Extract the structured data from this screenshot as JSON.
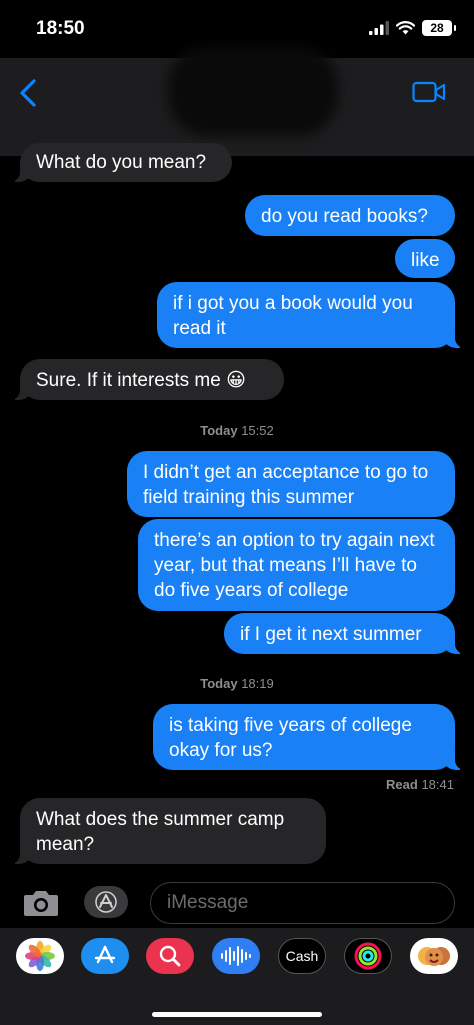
{
  "status_bar": {
    "time": "18:50",
    "battery": "28"
  },
  "messages": [
    {
      "id": "m1",
      "dir": "in",
      "text": "What do you mean?"
    },
    {
      "id": "m2",
      "dir": "out",
      "text": "do you read books?"
    },
    {
      "id": "m3",
      "dir": "out",
      "text": "like"
    },
    {
      "id": "m4",
      "dir": "out",
      "text": "if i got you a book would you read it"
    },
    {
      "id": "m5",
      "dir": "in",
      "text": "Sure. If it interests me 😀"
    },
    {
      "id": "m6",
      "dir": "out",
      "text": "I didn’t get an acceptance to go to field training this summer"
    },
    {
      "id": "m7",
      "dir": "out",
      "text": "there’s an option to try again next year, but that means I’ll have to do five years of college"
    },
    {
      "id": "m8",
      "dir": "out",
      "text": "if I get it next summer"
    },
    {
      "id": "m9",
      "dir": "out",
      "text": "is taking five years of college okay for us?"
    },
    {
      "id": "m10",
      "dir": "in",
      "text": "What does the summer camp mean?"
    }
  ],
  "timestamps": [
    {
      "day": "Today",
      "time": "15:52"
    },
    {
      "day": "Today",
      "time": "18:19"
    }
  ],
  "receipt": {
    "label": "Read",
    "time": "18:41"
  },
  "composer": {
    "placeholder": "iMessage"
  },
  "tray": {
    "apps": [
      "photos-icon",
      "app-store-icon",
      "search-images-icon",
      "audio-message-icon",
      "apple-cash-icon",
      "activity-icon",
      "memoji-icon"
    ],
    "cash_label": "Cash"
  },
  "colors": {
    "outgoing": "#1a80f6",
    "incoming": "#262628",
    "accent": "#0a84ff"
  }
}
